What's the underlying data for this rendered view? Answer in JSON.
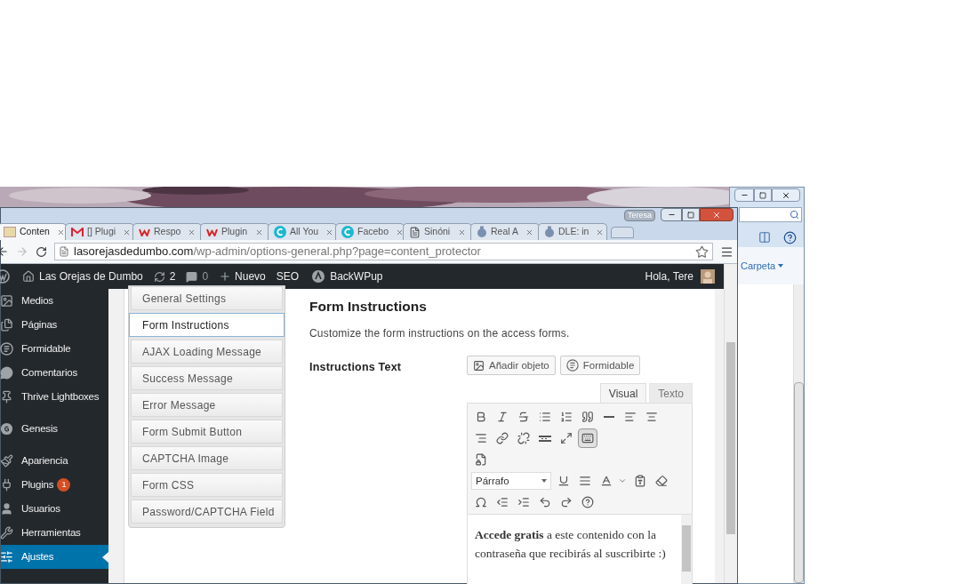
{
  "explorer": {
    "menu_label": "Carpeta"
  },
  "browser": {
    "profile": "Teresa",
    "tabs": [
      {
        "label": "Conten",
        "kind": "site",
        "selected": true
      },
      {
        "label": "[] Plugi",
        "kind": "mail",
        "selected": false
      },
      {
        "label": "Respo",
        "kind": "w",
        "selected": false
      },
      {
        "label": "Plugin",
        "kind": "w",
        "selected": false
      },
      {
        "label": "All You",
        "kind": "c",
        "selected": false
      },
      {
        "label": "Facebo",
        "kind": "c",
        "selected": false
      },
      {
        "label": "Sinóni",
        "kind": "doc",
        "selected": false
      },
      {
        "label": "Real A",
        "kind": "seal",
        "selected": false
      },
      {
        "label": "DLE: in",
        "kind": "seal",
        "selected": false
      }
    ],
    "url_host": "lasorejasdedumbo.com",
    "url_path": "/wp-admin/options-general.php?page=content_protector"
  },
  "admin_bar": {
    "site": "Las Orejas de Dumbo",
    "updates": "2",
    "comments": "0",
    "new": "Nuevo",
    "seo": "SEO",
    "backup": "BackWPup",
    "greeting": "Hola, Tere"
  },
  "sidebar": {
    "groups": [
      [
        {
          "label": "Medios",
          "kind": "media",
          "selected": false
        },
        {
          "label": "Páginas",
          "kind": "pages",
          "selected": false
        },
        {
          "label": "Formidable",
          "kind": "formidable",
          "selected": false
        },
        {
          "label": "Comentarios",
          "kind": "comments",
          "selected": false
        },
        {
          "label": "Thrive Lightboxes",
          "kind": "pin",
          "selected": false
        }
      ],
      [
        {
          "label": "Genesis",
          "kind": "genesis",
          "selected": false
        }
      ],
      [
        {
          "label": "Apariencia",
          "kind": "brush",
          "selected": false
        },
        {
          "label": "Plugins",
          "kind": "plugin",
          "selected": false,
          "badge": "1"
        },
        {
          "label": "Usuarios",
          "kind": "user",
          "selected": false
        },
        {
          "label": "Herramientas",
          "kind": "wrench",
          "selected": false
        },
        {
          "label": "Ajustes",
          "kind": "settings",
          "selected": true
        }
      ]
    ]
  },
  "settings_tabs": [
    {
      "label": "General Settings",
      "selected": false
    },
    {
      "label": "Form Instructions",
      "selected": true
    },
    {
      "label": "AJAX Loading Message",
      "selected": false
    },
    {
      "label": "Success Message",
      "selected": false
    },
    {
      "label": "Error Message",
      "selected": false
    },
    {
      "label": "Form Submit Button",
      "selected": false
    },
    {
      "label": "CAPTCHA Image",
      "selected": false
    },
    {
      "label": "Form CSS",
      "selected": false
    },
    {
      "label": "Password/CAPTCHA Field",
      "selected": false
    }
  ],
  "section": {
    "title": "Form Instructions",
    "description": "Customize the form instructions on the access forms.",
    "field_label": "Instructions Text",
    "media_buttons": [
      {
        "label": "Añadir objeto",
        "kind": "media"
      },
      {
        "label": "Formidable",
        "kind": "formidable"
      }
    ],
    "editor_tabs": [
      {
        "label": "Visual",
        "selected": true
      },
      {
        "label": "Texto",
        "selected": false
      }
    ],
    "toolbar_toggle_pressed": true,
    "format": "Párrafo",
    "content": "**Accede gratis** a este contenido con la contraseña que recibirás al suscribirte :)"
  }
}
